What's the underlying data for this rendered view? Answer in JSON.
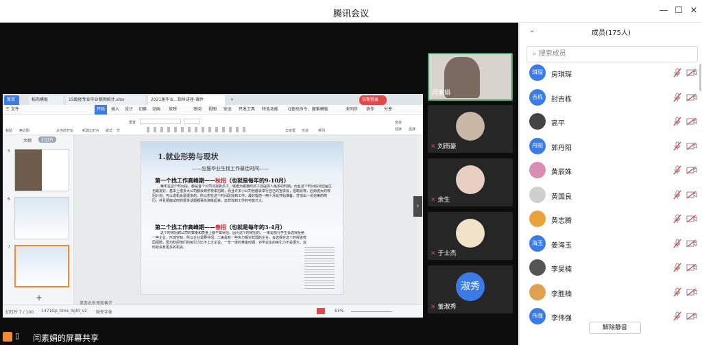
{
  "window": {
    "title": "腾讯会议"
  },
  "ppt": {
    "tabs": [
      "首页",
      "稻壳模板",
      "15级经专业毕业案例统计.xlsx",
      "2021届毕业...指导讲座-课件",
      "+"
    ],
    "login": "访客登录",
    "menu": [
      "三 文件",
      "开始",
      "插入",
      "设计",
      "切换",
      "动画",
      "放映",
      "审阅",
      "视图",
      "安全",
      "开发工具",
      "特色功能",
      "Q查找命令、搜索模板",
      "未同步",
      "协作",
      "分享"
    ],
    "tools": [
      "粘贴",
      "格式刷",
      "从当前开始",
      "新建幻灯片",
      "版式",
      "节",
      "重置",
      "文本框",
      "形状",
      "排列",
      "查找",
      "替换",
      "选择"
    ],
    "outline_tab": "大纲",
    "slides_tab": "幻灯片",
    "thumb_nums": [
      "5",
      "6",
      "7"
    ],
    "slide": {
      "title": "1.就业形势与现状",
      "subtitle": "——应届毕业生找工作最佳时间——",
      "h1_a": "第一个找工作高峰期——",
      "h1_b": "秋招",
      "h1_c": "（也就是每年的9-10月）",
      "p1": "每年在这个时间段，都是各个公司寻找新员工，或者为跳槽的员工找提供人最多的时期，而且这个时间段对应届生也最友好，基本上很多大公司都会到学校来招聘，而且许多小公司也都会举行自己的宣讲会，招聘会等，后劲庞大的校招计划，可以说机会是很多的，所以想在这个时间段找到工作，最好提前一两个月就开始准备，打造出一份完美的简历，并且把面试时的很多话题都事先演练起来，这样找到工作的可能才大。",
      "h2_a": "第二个找工作高峰期——",
      "h2_b": "春招",
      "h2_c": "（也就是每年的3-4月）",
      "p2": "这个时候招聘公司的数量和质量上都不如秋招，因为这个时候招的，一来是部分学生会选择拒绝一些企业，形成空缺，所以企业需要补招；二来是有一些实力相对较弱的企业，会选择在这个时候进校园招聘，因为秋招他们的吸引力比不上大企业，一年一度的黄金时期，对毕业生的吸引力不是很大，这时就会有更多的机会。"
    },
    "notes": "单击此处添加备注",
    "status": {
      "slide_num": "幻灯片 7 / 100",
      "theme": "1471Gp_time_light_v2",
      "font": "缺失字体",
      "zoom": "63%"
    }
  },
  "share": {
    "label": "闫素娟的屏幕共享"
  },
  "videos": [
    {
      "name": "闫素娟"
    },
    {
      "name": "刘雨豪"
    },
    {
      "name": "余生"
    },
    {
      "name": "于士杰"
    },
    {
      "name": "董淑秀",
      "avatar_text": "淑秀"
    }
  ],
  "members": {
    "header": "成员(175人)",
    "search_placeholder": "搜索成员",
    "list": [
      {
        "avatar": "琪琛",
        "name": "房琪琛",
        "color": "#3b7be8"
      },
      {
        "avatar": "吉栋",
        "name": "封吉栋",
        "color": "#3b7be8"
      },
      {
        "avatar": "",
        "name": "高平",
        "color": "#444444"
      },
      {
        "avatar": "丹阳",
        "name": "郭丹阳",
        "color": "#3b7be8"
      },
      {
        "avatar": "",
        "name": "黄辰姝",
        "color": "#d98db0"
      },
      {
        "avatar": "",
        "name": "黄国良",
        "color": "#cfcfcf"
      },
      {
        "avatar": "",
        "name": "黄志腾",
        "color": "#e8a33b"
      },
      {
        "avatar": "海玉",
        "name": "姜海玉",
        "color": "#3b7be8"
      },
      {
        "avatar": "",
        "name": "李昊楠",
        "color": "#555555"
      },
      {
        "avatar": "",
        "name": "李胜楠",
        "color": "#e0a050"
      },
      {
        "avatar": "伟强",
        "name": "李伟强",
        "color": "#3b7be8"
      }
    ],
    "unmute_all": "解除静音"
  }
}
